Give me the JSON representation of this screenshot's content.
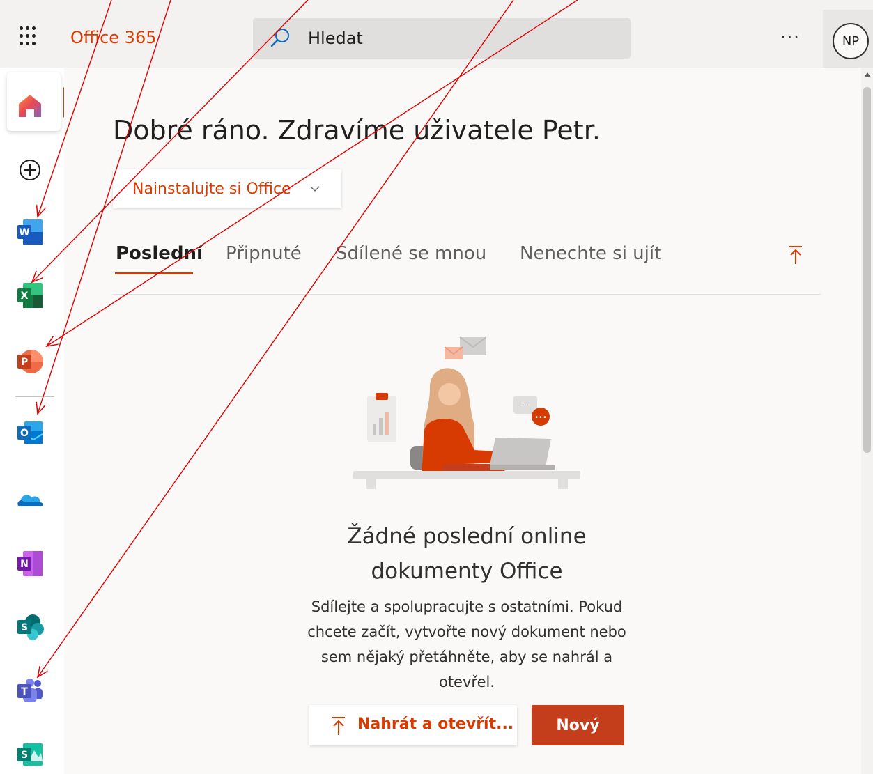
{
  "header": {
    "brand": "Office 365",
    "search_placeholder": "Hledat",
    "more_label": "···",
    "avatar_initials": "NP"
  },
  "rail": {
    "items": [
      {
        "name": "home",
        "icon": "home-icon"
      },
      {
        "name": "create",
        "icon": "plus-circle-icon"
      },
      {
        "name": "word",
        "icon": "word-icon",
        "letter": "W",
        "color": "#185abd"
      },
      {
        "name": "excel",
        "icon": "excel-icon",
        "letter": "X",
        "color": "#107c41"
      },
      {
        "name": "powerpoint",
        "icon": "powerpoint-icon",
        "letter": "P",
        "color": "#c43e1c"
      },
      {
        "name": "outlook",
        "icon": "outlook-icon",
        "letter": "O",
        "color": "#0f6cbd"
      },
      {
        "name": "onedrive",
        "icon": "onedrive-icon",
        "color": "#0f6cbd"
      },
      {
        "name": "onenote",
        "icon": "onenote-icon",
        "letter": "N",
        "color": "#7719aa"
      },
      {
        "name": "sharepoint",
        "icon": "sharepoint-icon",
        "letter": "S",
        "color": "#03787c"
      },
      {
        "name": "teams",
        "icon": "teams-icon",
        "letter": "T",
        "color": "#4b53bc"
      },
      {
        "name": "sway",
        "icon": "sway-icon",
        "letter": "S",
        "color": "#008272"
      }
    ]
  },
  "main": {
    "greeting": "Dobré ráno. Zdravíme uživatele Petr.",
    "install_button": "Nainstalujte si Office",
    "tabs": [
      {
        "label": "Poslední",
        "active": true
      },
      {
        "label": "Připnuté",
        "active": false
      },
      {
        "label": "Sdílené se mnou",
        "active": false
      },
      {
        "label": "Nenechte si ujít",
        "active": false
      }
    ],
    "empty_state": {
      "title_line1": "Žádné poslední online",
      "title_line2": "dokumenty Office",
      "desc_line1": "Sdílejte a spolupracujte s ostatními. Pokud",
      "desc_line2": "chcete začít, vytvořte nový dokument nebo",
      "desc_line3": "sem nějaký přetáhněte, aby se nahrál a",
      "desc_line4": "otevřel."
    },
    "upload_button": "Nahrát a otevřít...",
    "new_button": "Nový"
  },
  "colors": {
    "accent": "#d83b01",
    "primary_button": "#c43e1c",
    "annotation_arrow": "#e00000"
  }
}
